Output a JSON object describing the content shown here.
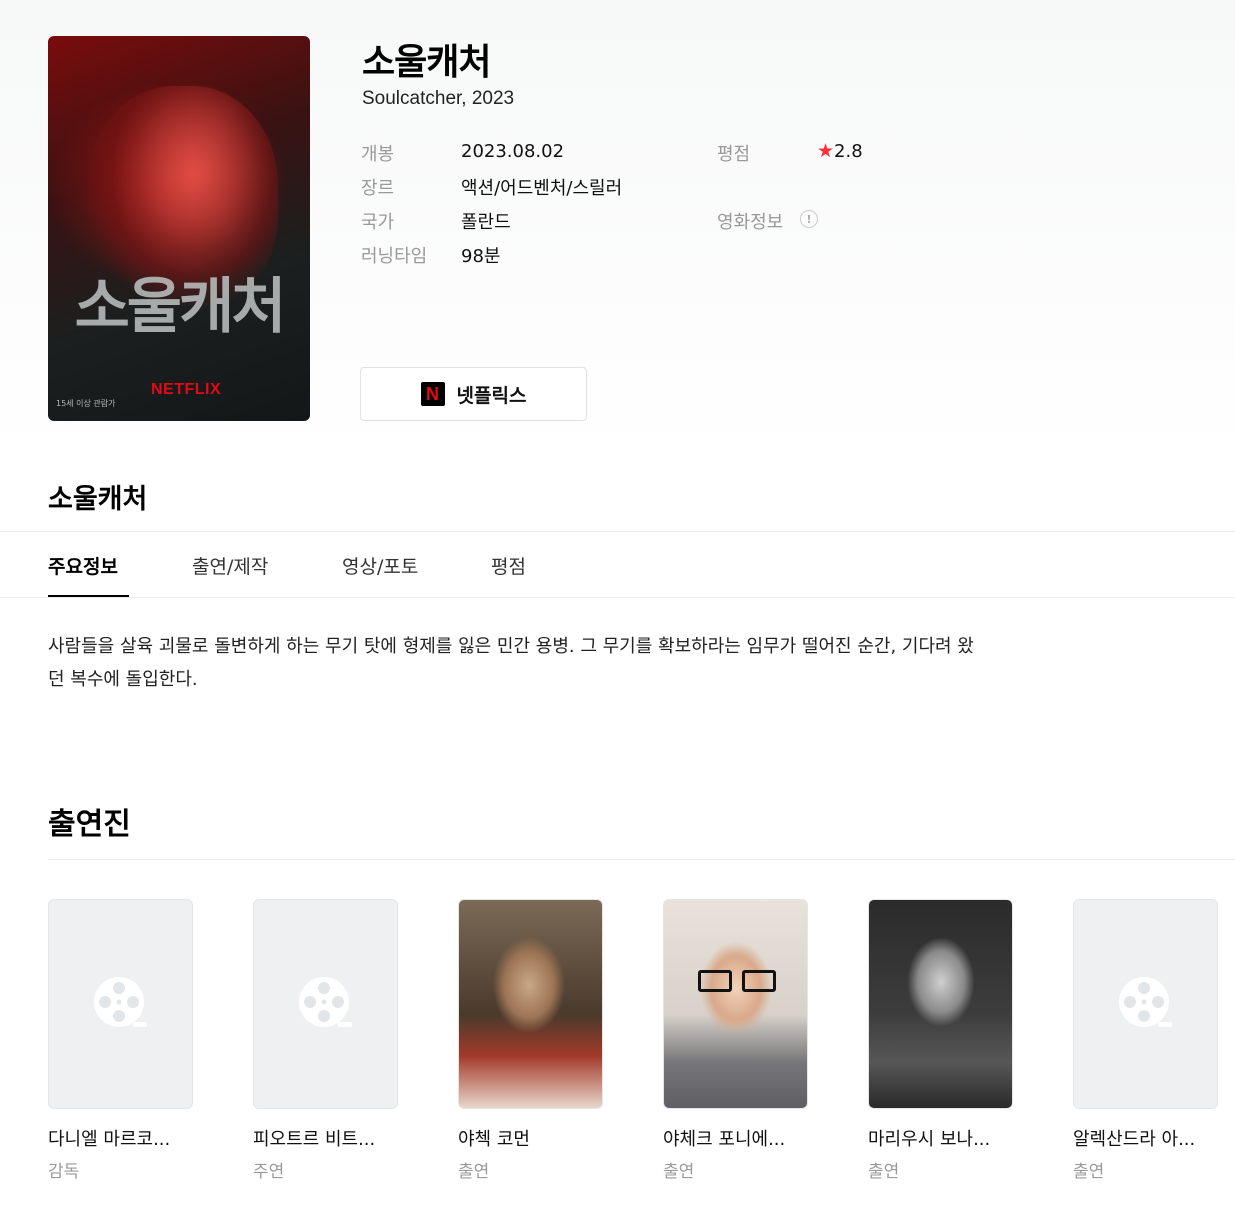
{
  "movie": {
    "title_ko": "소울캐처",
    "subtitle": "Soulcatcher, 2023",
    "poster": {
      "title_text": "소울캐처",
      "brand_text": "NETFLIX",
      "age_rating": "15세 이상 관람가"
    },
    "info": {
      "release_label": "개봉",
      "release_value": "2023.08.02",
      "genre_label": "장르",
      "genre_value": "액션/어드벤처/스릴러",
      "country_label": "국가",
      "country_value": "폴란드",
      "runtime_label": "러닝타임",
      "runtime_value": "98분",
      "rating_label": "평점",
      "rating_value": "2.8",
      "movieinfo_label": "영화정보",
      "info_icon_glyph": "!"
    },
    "streaming": {
      "logo_letter": "N",
      "label": "넷플릭스"
    }
  },
  "section_title": "소울캐처",
  "tabs": [
    {
      "label": "주요정보",
      "active": true
    },
    {
      "label": "출연/제작",
      "active": false
    },
    {
      "label": "영상/포토",
      "active": false
    },
    {
      "label": "평점",
      "active": false
    }
  ],
  "synopsis": {
    "line1": "사람들을 살육 괴물로 돌변하게 하는 무기 탓에 형제를 잃은 민간 용병. 그 무기를 확보하라는 임무가 떨어진 순간, 기다려 왔",
    "line2": "던 복수에 돌입한다."
  },
  "cast_title": "출연진",
  "cast": [
    {
      "name": "다니엘 마르코...",
      "role": "감독",
      "photo": "placeholder-film-icon"
    },
    {
      "name": "피오트르 비트...",
      "role": "주연",
      "photo": "placeholder-film-icon"
    },
    {
      "name": "야첵 코먼",
      "role": "출연",
      "photo": "photo"
    },
    {
      "name": "야체크 포니에...",
      "role": "출연",
      "photo": "photo"
    },
    {
      "name": "마리우시 보나...",
      "role": "출연",
      "photo": "photo"
    },
    {
      "name": "알렉산드라 아...",
      "role": "출연",
      "photo": "placeholder-film-icon"
    }
  ],
  "colors": {
    "accent_star": "#ff2d3a",
    "netflix_red": "#e50914",
    "muted_text": "#999999"
  }
}
